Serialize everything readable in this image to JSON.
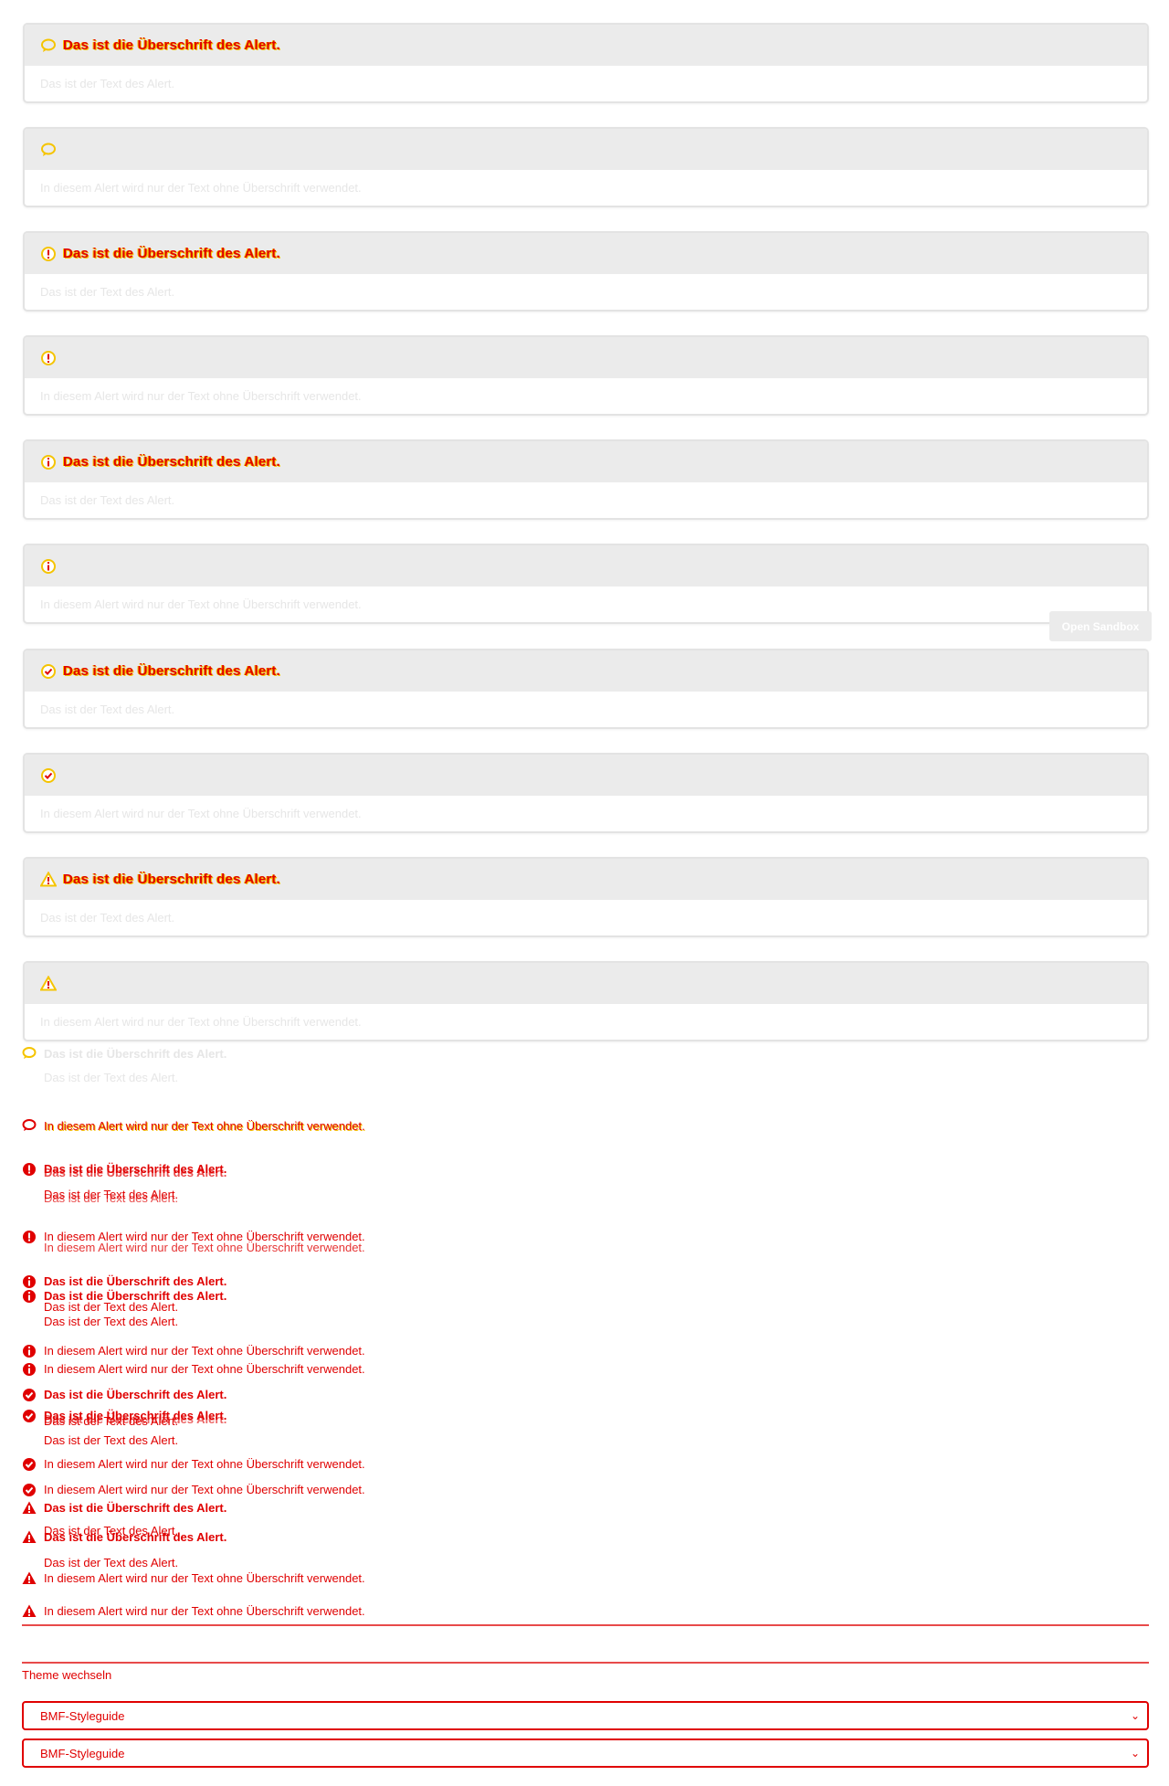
{
  "colors": {
    "card_header_bg": "#ebebeb",
    "card_border": "#e3e3e3",
    "text_red": "#e00000",
    "icon_yellow": "#f5c400",
    "faded_text": "#e6e6e6"
  },
  "card_alerts": [
    {
      "icon": "speech-bubble-icon",
      "title": "Das ist die Überschrift des Alert.",
      "text": "Das ist der Text des Alert."
    },
    {
      "icon": "speech-bubble-icon",
      "title": "",
      "text": "In diesem Alert wird nur der Text ohne Überschrift verwendet."
    },
    {
      "icon": "exclamation-circle-icon",
      "title": "Das ist die Überschrift des Alert.",
      "text": "Das ist der Text des Alert."
    },
    {
      "icon": "exclamation-circle-icon",
      "title": "",
      "text": "In diesem Alert wird nur der Text ohne Überschrift verwendet."
    },
    {
      "icon": "info-circle-icon",
      "title": "Das ist die Überschrift des Alert.",
      "text": "Das ist der Text des Alert."
    },
    {
      "icon": "info-circle-icon",
      "title": "",
      "text": "In diesem Alert wird nur der Text ohne Überschrift verwendet."
    },
    {
      "icon": "check-circle-icon",
      "title": "Das ist die Überschrift des Alert.",
      "text": "Das ist der Text des Alert."
    },
    {
      "icon": "check-circle-icon",
      "title": "",
      "text": "In diesem Alert wird nur der Text ohne Überschrift verwendet."
    },
    {
      "icon": "warning-triangle-icon",
      "title": "Das ist die Überschrift des Alert.",
      "text": "Das ist der Text des Alert."
    },
    {
      "icon": "warning-triangle-icon",
      "title": "",
      "text": "In diesem Alert wird nur der Text ohne Überschrift verwendet."
    }
  ],
  "sandbox_button": "Open Sandbox",
  "inline_alerts": {
    "title": "Das ist die Überschrift des Alert.",
    "text": "Das ist der Text des Alert.",
    "text_only": "In diesem Alert wird nur der Text ohne Überschrift verwendet."
  },
  "theme": {
    "label": "Theme wechseln",
    "selected": "BMF-Styleguide"
  }
}
